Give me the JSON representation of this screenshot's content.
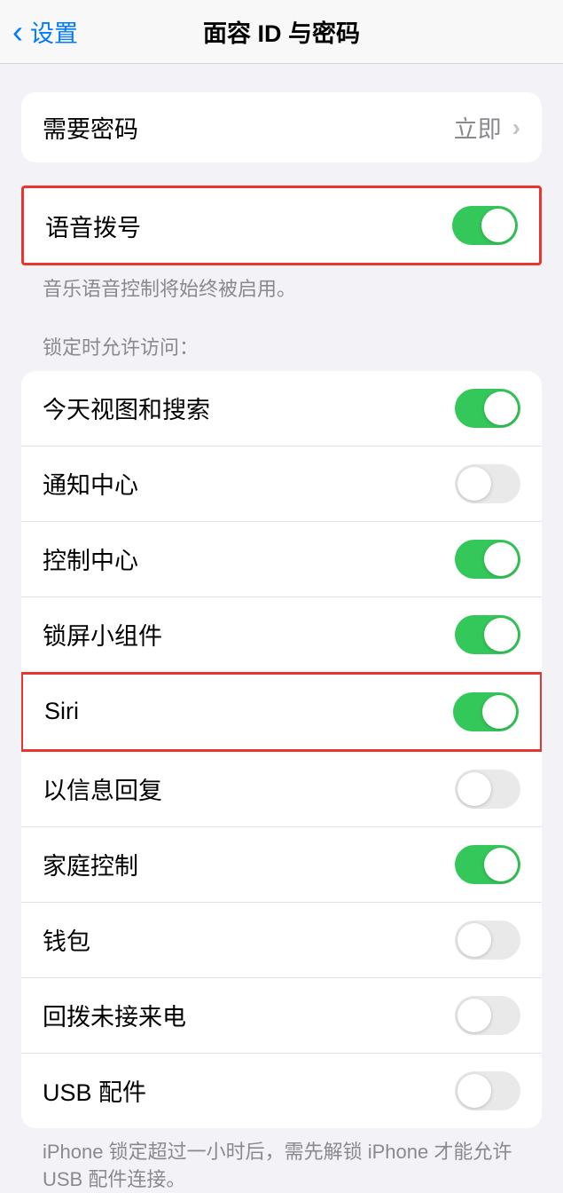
{
  "nav": {
    "back_label": "设置",
    "title": "面容 ID 与密码"
  },
  "group1": {
    "require_passcode_label": "需要密码",
    "require_passcode_value": "立即"
  },
  "group2": {
    "voice_dial_label": "语音拨号",
    "voice_dial_on": true,
    "footer": "音乐语音控制将始终被启用。"
  },
  "group3": {
    "header": "锁定时允许访问：",
    "items": [
      {
        "label": "今天视图和搜索",
        "on": true
      },
      {
        "label": "通知中心",
        "on": false
      },
      {
        "label": "控制中心",
        "on": true
      },
      {
        "label": "锁屏小组件",
        "on": true
      },
      {
        "label": "Siri",
        "on": true
      },
      {
        "label": "以信息回复",
        "on": false
      },
      {
        "label": "家庭控制",
        "on": true
      },
      {
        "label": "钱包",
        "on": false
      },
      {
        "label": "回拨未接来电",
        "on": false
      },
      {
        "label": "USB 配件",
        "on": false
      }
    ],
    "footer": "iPhone 锁定超过一小时后，需先解锁 iPhone 才能允许 USB 配件连接。"
  }
}
